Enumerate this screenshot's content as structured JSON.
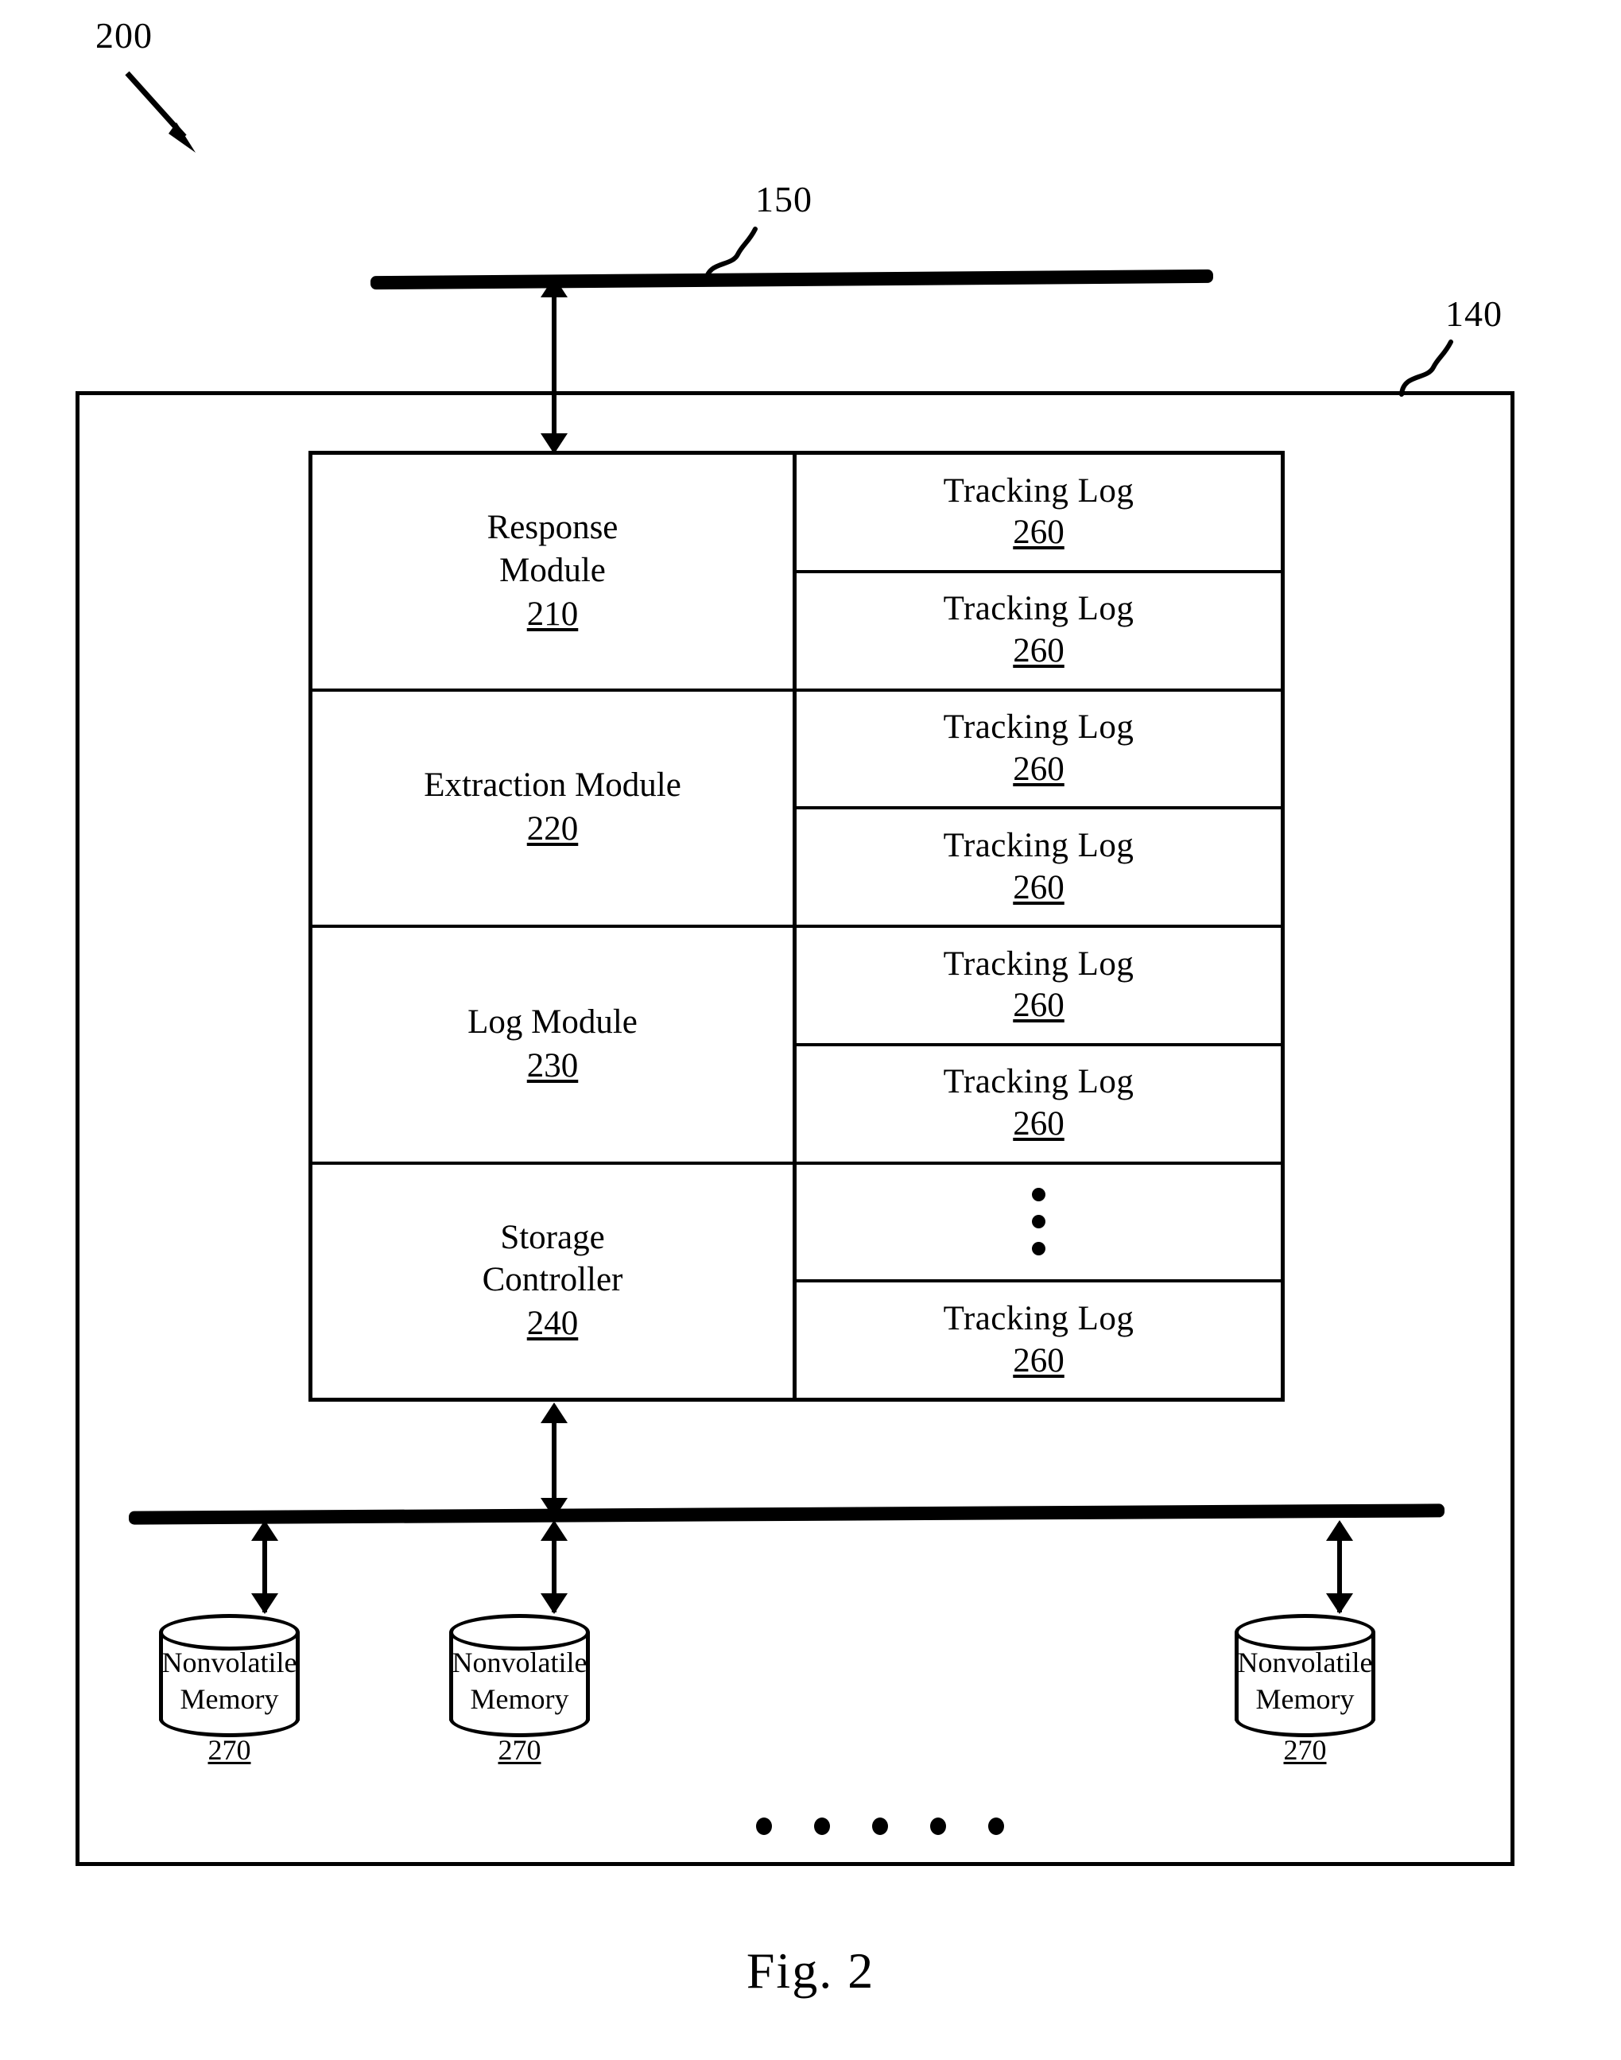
{
  "figure": {
    "caption": "Fig. 2",
    "system_numeral": "200",
    "device_numeral": "140",
    "bus_numeral": "150"
  },
  "modules": [
    {
      "title": "Response\nModule",
      "numeral": "210",
      "name": "response-module"
    },
    {
      "title": "Extraction Module",
      "numeral": "220",
      "name": "extraction-module"
    },
    {
      "title": "Log Module",
      "numeral": "230",
      "name": "log-module"
    },
    {
      "title": "Storage\nController",
      "numeral": "240",
      "name": "storage-controller"
    }
  ],
  "tracking_logs": [
    {
      "title": "Tracking  Log",
      "numeral": "260",
      "kind": "log"
    },
    {
      "title": "Tracking  Log",
      "numeral": "260",
      "kind": "log"
    },
    {
      "title": "Tracking  Log",
      "numeral": "260",
      "kind": "log"
    },
    {
      "title": "Tracking  Log",
      "numeral": "260",
      "kind": "log"
    },
    {
      "title": "Tracking  Log",
      "numeral": "260",
      "kind": "log"
    },
    {
      "title": "Tracking  Log",
      "numeral": "260",
      "kind": "log"
    },
    {
      "title": "",
      "numeral": "",
      "kind": "ellipsis"
    },
    {
      "title": "Tracking  Log",
      "numeral": "260",
      "kind": "log"
    }
  ],
  "memories": [
    {
      "title": "Nonvolatile\nMemory",
      "numeral": "270"
    },
    {
      "title": "Nonvolatile\nMemory",
      "numeral": "270"
    },
    {
      "title": "Nonvolatile\nMemory",
      "numeral": "270"
    }
  ],
  "memory_ellipsis_dots": 5,
  "colors": {
    "ink": "#000000",
    "paper": "#ffffff"
  }
}
